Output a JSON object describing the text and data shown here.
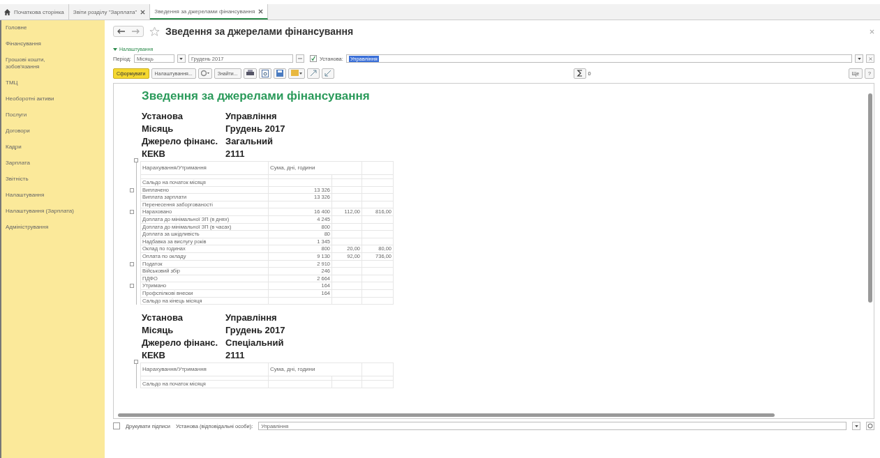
{
  "tabs": [
    {
      "label": "Початкова сторінка",
      "kind": "home",
      "selected": false,
      "closable": false
    },
    {
      "label": "Звіти розділу \"Зарплата\"",
      "kind": "page",
      "selected": false,
      "closable": true
    },
    {
      "label": "Зведення за джерелами фінансування",
      "kind": "page",
      "selected": true,
      "closable": true
    }
  ],
  "sidebar": {
    "items": [
      "Головне",
      "Фінансування",
      "Грошові кошти, зобов'язання",
      "ТМЦ",
      "Необоротні активи",
      "Послуги",
      "Договори",
      "Кадри",
      "Зарплата",
      "Звітність",
      "Налаштування",
      "Налаштування (Зарплата)",
      "Адміністрування"
    ]
  },
  "form": {
    "title": "Зведення за джерелами фінансування",
    "settings_toggle": "Налаштування",
    "expanded": true,
    "period_label": "Період:",
    "period_kind": "Місяць",
    "period_value": "Грудень 2017",
    "org_checked": true,
    "org_label": "Установа:",
    "org_value": "Управління",
    "toolbar": [
      "Сформувати",
      "Налаштування...",
      "Знайти..."
    ],
    "sum_value": "0",
    "more": "Ще",
    "help": "?"
  },
  "report": {
    "title": "Зведення за джерелами фінансування",
    "sections": [
      {
        "header": [
          [
            "Установа",
            "Управління"
          ],
          [
            "Місяць",
            "Грудень 2017"
          ],
          [
            "Джерело фінанс.",
            "Загальний"
          ],
          [
            "КЕКВ",
            "2111"
          ]
        ],
        "columns": [
          "Нарахування/Утримання",
          "Сума, дні, години"
        ],
        "rows": [
          {
            "cells": [
              "Сальдо на початок місяця",
              "",
              "",
              ""
            ],
            "group": false
          },
          {
            "cells": [
              "Виплачено",
              "13 326",
              "",
              ""
            ],
            "group": true
          },
          {
            "cells": [
              "Виплата зарплати",
              "13 326",
              "",
              ""
            ],
            "group": false
          },
          {
            "cells": [
              "Перенесення заборгованості",
              "",
              "",
              ""
            ],
            "group": false
          },
          {
            "cells": [
              "Нараховано",
              "16 400",
              "112,00",
              "816,00"
            ],
            "group": true
          },
          {
            "cells": [
              "Доплата до мінімальної ЗП (в днях)",
              "4 245",
              "",
              ""
            ],
            "group": false
          },
          {
            "cells": [
              "Доплата до мінімальної ЗП (в часах)",
              "800",
              "",
              ""
            ],
            "group": false
          },
          {
            "cells": [
              "Доплата за шкідливість",
              "80",
              "",
              ""
            ],
            "group": false
          },
          {
            "cells": [
              "Надбавка за вислугу років",
              "1 345",
              "",
              ""
            ],
            "group": false
          },
          {
            "cells": [
              "Оклад по годинах",
              "800",
              "20,00",
              "80,00"
            ],
            "group": false
          },
          {
            "cells": [
              "Оплата по окладу",
              "9 130",
              "92,00",
              "736,00"
            ],
            "group": false
          },
          {
            "cells": [
              "Податок",
              "2 910",
              "",
              ""
            ],
            "group": true
          },
          {
            "cells": [
              "Військовий збір",
              "246",
              "",
              ""
            ],
            "group": false
          },
          {
            "cells": [
              "ПДФО",
              "2 664",
              "",
              ""
            ],
            "group": false
          },
          {
            "cells": [
              "Утримано",
              "164",
              "",
              ""
            ],
            "group": true
          },
          {
            "cells": [
              "Профспілкові внески",
              "164",
              "",
              ""
            ],
            "group": false
          },
          {
            "cells": [
              "Сальдо на кінець місяця",
              "",
              "",
              ""
            ],
            "group": false
          }
        ]
      },
      {
        "header": [
          [
            "Установа",
            "Управління"
          ],
          [
            "Місяць",
            "Грудень 2017"
          ],
          [
            "Джерело фінанс.",
            "Спеціальний"
          ],
          [
            "КЕКВ",
            "2111"
          ]
        ],
        "columns": [
          "Нарахування/Утримання",
          "Сума, дні, години"
        ],
        "rows": [
          {
            "cells": [
              "Сальдо на початок місяця",
              "",
              "",
              ""
            ],
            "group": false
          }
        ]
      }
    ]
  },
  "footer": {
    "print_signatures": false,
    "print_label": "Друкувати підписи",
    "org_label": "Установа (відповідальні особи):",
    "org_value": "Управління"
  }
}
